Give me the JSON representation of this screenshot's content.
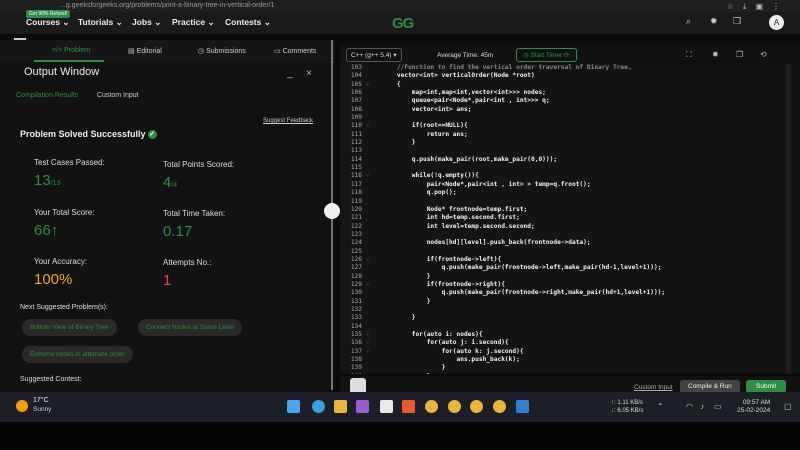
{
  "browser": {
    "url": "...g.geeksforgeeks.org/problems/print-a-binary-tree-in-vertical-order/1",
    "icons": [
      "star-icon",
      "download-icon",
      "extension-icon",
      "menu-icon"
    ]
  },
  "nav": {
    "badge": "Get 90% Refund!",
    "items": [
      "Courses",
      "Tutorials",
      "Jobs",
      "Practice",
      "Contests"
    ],
    "logo": "GG",
    "avatar": "A"
  },
  "tabs": {
    "problem": "</> Problem",
    "editorial": "Editorial",
    "submissions": "Submissions",
    "comments": "Comments"
  },
  "output": {
    "title": "Output Window",
    "minimize": "_",
    "close": "×",
    "compilation_results": "Compilation Results",
    "custom_input": "Custom Input",
    "suggest_feedback": "Suggest Feedback",
    "solved": "Problem Solved Successfully",
    "test_cases_label": "Test Cases Passed:",
    "test_cases_value": "13",
    "test_cases_total": "/13",
    "points_label": "Total Points Scored:",
    "points_value": "4",
    "points_total": "/4",
    "score_label": "Your Total Score:",
    "score_value": "66",
    "score_arrow": "↑",
    "time_label": "Total Time Taken:",
    "time_value": "0.17",
    "accuracy_label": "Your Accuracy:",
    "accuracy_value": "100%",
    "attempts_label": "Attempts No.:",
    "attempts_value": "1",
    "next_label": "Next Suggested Problem(s):",
    "suggestions": [
      "Bottom View of Binary Tree",
      "Connect Nodes at Same Level",
      "Extreme nodes in alternate order"
    ],
    "contest_label": "Suggested Contest:"
  },
  "editor": {
    "language": "C++ (g++ 5.4) ▾",
    "avg_time": "Average Time: 45m",
    "timer": "◷ Start Timer ⟳",
    "line_numbers": [
      "103",
      "104",
      "105",
      "106",
      "107",
      "108",
      "109",
      "110",
      "111",
      "112",
      "113",
      "114",
      "115",
      "116",
      "117",
      "118",
      "119",
      "120",
      "121",
      "122",
      "123",
      "124",
      "125",
      "126",
      "127",
      "128",
      "129",
      "130",
      "131",
      "132",
      "133",
      "134",
      "135",
      "136",
      "137",
      "138",
      "139",
      "140"
    ],
    "code": [
      "    //Function to find the vertical order traversal of Binary Tree.",
      "    vector<int> verticalOrder(Node *root)",
      "    {",
      "        map<int,map<int,vector<int>>> nodes;",
      "        queue<pair<Node*,pair<int , int>>> q;",
      "        vector<int> ans;",
      "",
      "        if(root==NULL){",
      "            return ans;",
      "        }",
      "",
      "        q.push(make_pair(root,make_pair(0,0)));",
      "",
      "        while(!q.empty()){",
      "            pair<Node*,pair<int , int> > temp=q.front();",
      "            q.pop();",
      "",
      "            Node* frontnode=temp.first;",
      "            int hd=temp.second.first;",
      "            int level=temp.second.second;",
      "",
      "            nodes[hd][level].push_back(frontnode->data);",
      "",
      "            if(frontnode->left){",
      "                q.push(make_pair(frontnode->left,make_pair(hd-1,level+1)));",
      "            }",
      "            if(frontnode->right){",
      "                q.push(make_pair(frontnode->right,make_pair(hd+1,level+1)));",
      "            }",
      "",
      "        }",
      "",
      "        for(auto i: nodes){",
      "            for(auto j: i.second){",
      "                for(auto k: j.second){",
      "                    ans.push_back(k);",
      "                }",
      "            }"
    ],
    "custom_input": "Custom Input",
    "compile_run": "Compile & Run",
    "submit": "Submit"
  },
  "taskbar": {
    "temp": "17°C",
    "condition": "Sunny",
    "net_up": "↑: 1.11 KB/s",
    "net_down": "↓: 6.05 KB/s",
    "lang": "ENG\nIN",
    "time": "09:57 AM",
    "date": "25-02-2024"
  },
  "colors": {
    "accent": "#2f8d46",
    "orange": "#f5a623",
    "red": "#e74c3c"
  }
}
